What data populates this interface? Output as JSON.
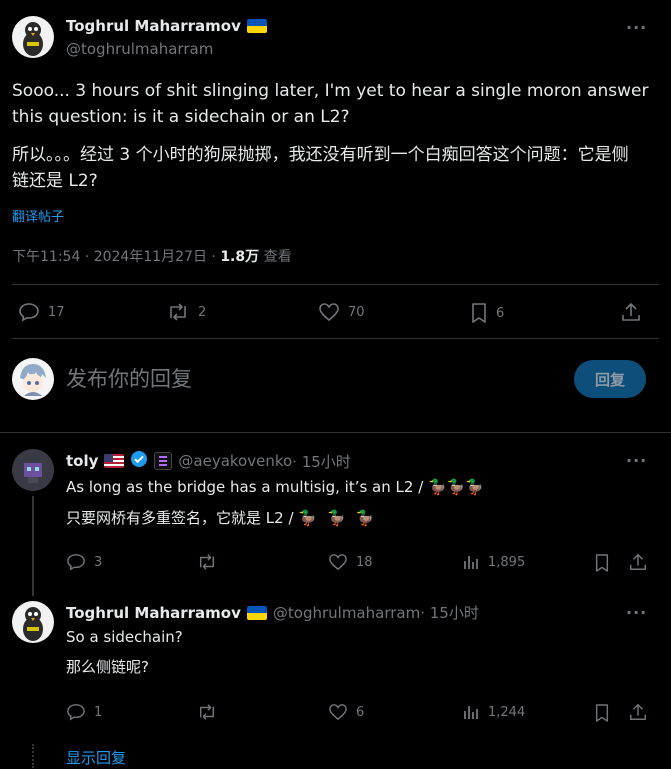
{
  "main_post": {
    "author_name": "Toghrul Maharramov",
    "author_handle": "@toghrulmaharram",
    "text_en": "Sooo... 3 hours of shit slinging later, I'm yet to hear a single moron answer this question: is it a sidechain or an L2?",
    "text_zh": "所以。。。经过 3 个小时的狗屎抛掷，我还没有听到一个白痴回答这个问题：它是侧链还是 L2?",
    "translate_link": "翻译帖子",
    "timestamp": "下午11:54 · 2024年11月27日 · ",
    "views_count": "1.8万",
    "views_label": " 查看",
    "replies": "17",
    "reposts": "2",
    "likes": "70",
    "bookmarks": "6"
  },
  "composer": {
    "placeholder": "发布你的回复",
    "reply_button": "回复"
  },
  "replies": [
    {
      "author_name": "toly",
      "author_handle": "@aeyakovenko",
      "time": " · 15小时",
      "text_en": "As long as the bridge has a multisig, it’s an L2 / ",
      "text_zh": "只要网桥有多重签名，它就是 L2 / ",
      "ducks": "🦆🦆🦆",
      "replies": "3",
      "likes": "18",
      "views": "1,895"
    },
    {
      "author_name": "Toghrul Maharramov",
      "author_handle": "@toghrulmaharram",
      "time": " · 15小时",
      "text_en": "So a sidechain?",
      "text_zh": "那么侧链呢?",
      "replies": "1",
      "likes": "6",
      "views": "1,244"
    }
  ],
  "show_replies": "显示回复",
  "colors": {
    "accent": "#1d9bf0",
    "reply_button_bg": "#0e4e7a",
    "ukraine_blue": "#0057b7",
    "ukraine_yellow": "#ffd700",
    "verified": "#1d9bf0"
  }
}
